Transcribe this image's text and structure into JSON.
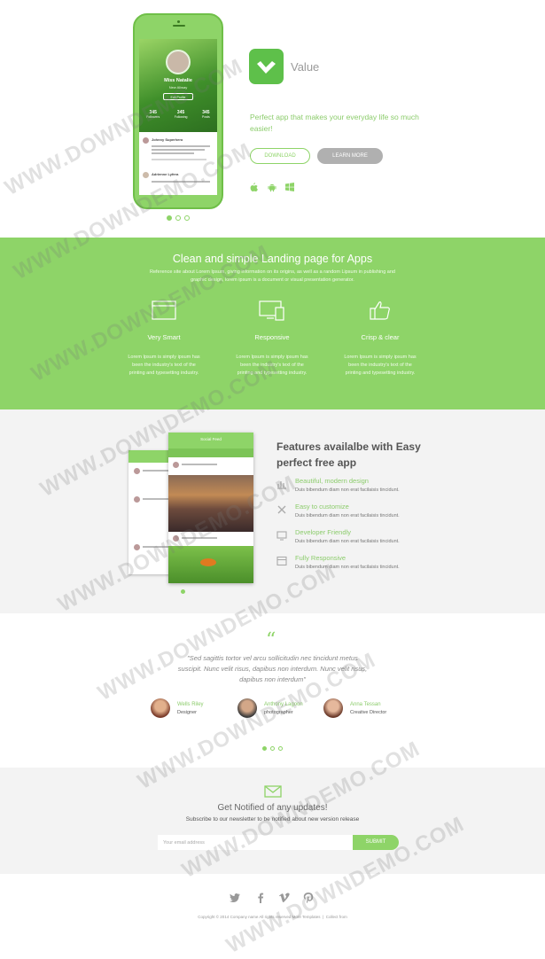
{
  "hero": {
    "app_name": "Value",
    "tagline": "Perfect app that makes your everyday life so much easier!",
    "download_label": "DOWNLOAD",
    "learn_more_label": "LEARN MORE",
    "phone": {
      "profile_name": "Miss Natalie",
      "profile_role": "New Aliway",
      "button": "Edit Profile",
      "stats": [
        {
          "value": "345",
          "label": "Followers"
        },
        {
          "value": "345",
          "label": "Following"
        },
        {
          "value": "345",
          "label": "Posts"
        }
      ],
      "post1_name": "Johnny Superhero",
      "post2_name": "Adrienne Lyfera"
    },
    "os_icons": [
      "apple-icon",
      "android-icon",
      "windows-icon"
    ],
    "slider_dots_active": 0
  },
  "intro": {
    "title": "Clean and simple Landing page for Apps",
    "subtitle": "Reference site about Lorem Ipsum, giving information on its origins, as well as a random Lipsum in publishing and graphic design, lorem ipsum is a document or visual presentation generator.",
    "columns": [
      {
        "icon": "browser-window-icon",
        "title": "Very Smart",
        "text": "Lorem Ipsum is simply ipsum has been the industry's text of the printing and typesetting industry."
      },
      {
        "icon": "devices-icon",
        "title": "Responsive",
        "text": "Lorem Ipsum is simply ipsum has been the industry's text of the printing and typesetting industry."
      },
      {
        "icon": "thumbs-up-icon",
        "title": "Crisp & clear",
        "text": "Lorem Ipsum is simply ipsum has been the industry's text of the printing and typesetting industry."
      }
    ]
  },
  "features": {
    "title": "Features availalbe with Easy perfect free app",
    "mock_title": "Social Feed",
    "items": [
      {
        "icon": "chart-icon",
        "title": "Beautiful, modern design",
        "text": "Duis bibendum diam non erat facilaisis tincidunt."
      },
      {
        "icon": "tools-icon",
        "title": "Easy to customize",
        "text": "Duis bibendum diam non erat facilaisis tincidunt."
      },
      {
        "icon": "monitor-icon",
        "title": "Developer Friendly",
        "text": "Duis bibendum diam non erat facilaisis tincidunt."
      },
      {
        "icon": "layout-icon",
        "title": "Fully Responsive",
        "text": "Duis bibendum diam non erat facilaisis tincidunt."
      }
    ]
  },
  "testimonial": {
    "quote_mark": "“",
    "quote": "\"Sed sagittis tortor vel arcu sollicitudin nec tincidunt metus suscipit. Nunc velit risus, dapibus non interdum. Nunc velit risus, dapibus non interdum\"",
    "people": [
      {
        "name": "Wells Riley",
        "role": "Designer"
      },
      {
        "name": "Anthony Lagoon",
        "role": "photographer"
      },
      {
        "name": "Anna Tessan",
        "role": "Creative Director"
      }
    ]
  },
  "newsletter": {
    "title": "Get Notified of any updates!",
    "subtitle": "Subscribe to our newsletter to be notified about new version release",
    "placeholder": "Your email address",
    "submit_label": "SUBMIT"
  },
  "footer": {
    "social": [
      "twitter-icon",
      "facebook-icon",
      "vimeo-icon",
      "pinterest-icon"
    ],
    "copyright": "Copyright © 2014 Company name All rights reserved More Templates",
    "contact": "Collect from"
  },
  "watermark": "WWW.DOWNDEMO.COM",
  "colors": {
    "accent": "#8ed468",
    "accent_text": "#8ccc6c",
    "grey_button": "#b0b0b0",
    "band_grey": "#f3f3f3"
  }
}
